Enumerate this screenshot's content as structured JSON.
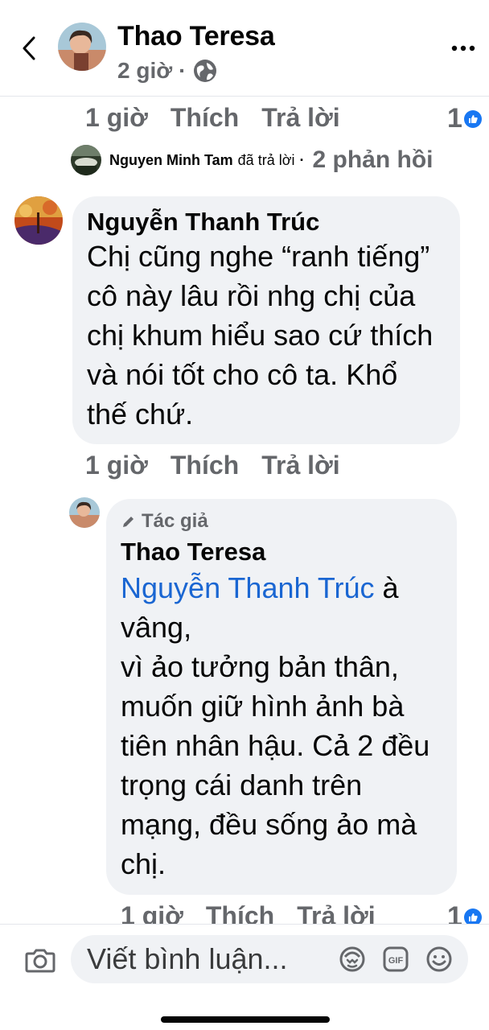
{
  "header": {
    "name": "Thao Teresa",
    "time": "2 giờ",
    "dot": "·",
    "more": "•••"
  },
  "top_actions": {
    "time": "1 giờ",
    "like": "Thích",
    "reply": "Trả lời",
    "reaction_count": "1"
  },
  "replied_row": {
    "name": "Nguyen Minh Tam",
    "verb": "đã trả lời",
    "dot": "·",
    "count": "2 phản hồi"
  },
  "comment1": {
    "author": "Nguyễn Thanh Trúc",
    "text": "Chị cũng nghe “ranh tiếng” cô này lâu rồi nhg chị của chị khum hiểu sao cứ thích và nói tốt cho cô ta. Khổ thế chứ.",
    "time": "1 giờ",
    "like": "Thích",
    "reply": "Trả lời"
  },
  "comment2": {
    "badge": "Tác giả",
    "author": "Thao Teresa",
    "mention": "Nguyễn Thanh Trúc",
    "text_after_mention": " à vâng,",
    "line2": "vì ảo tưởng bản thân, muốn giữ hình ảnh bà tiên nhân hậu. Cả 2 đều trọng cái danh trên mạng, đều sống ảo mà chị.",
    "time": "1 giờ",
    "like": "Thích",
    "reply": "Trả lời",
    "reaction_count": "1"
  },
  "composer": {
    "placeholder": "Viết bình luận..."
  },
  "icons": {
    "back": "chevron-left-icon",
    "globe": "globe-icon",
    "more": "more-icon",
    "like": "thumbs-up-icon",
    "camera": "camera-icon",
    "avatar_sticker": "avatar-sticker-icon",
    "gif": "gif-icon",
    "emoji": "emoji-icon",
    "pencil": "pencil-icon"
  },
  "colors": {
    "accent": "#1877f2",
    "mention": "#1a66d2",
    "bubble": "#f0f2f5",
    "muted": "#65676b"
  }
}
